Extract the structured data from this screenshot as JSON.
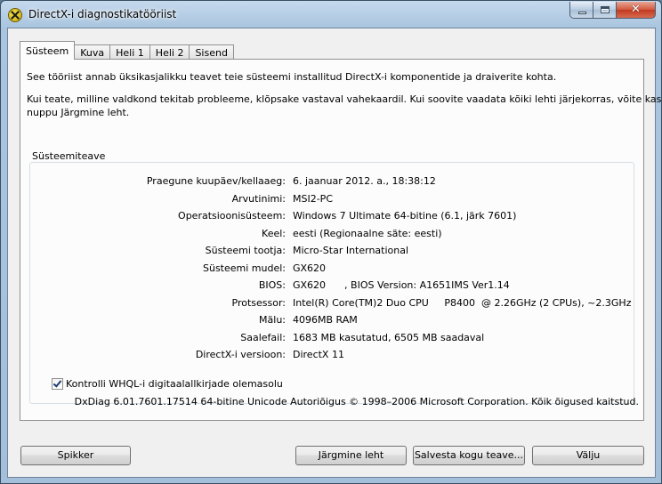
{
  "window": {
    "title": "DirectX-i diagnostikatööriist"
  },
  "tabs": [
    {
      "label": "Süsteem",
      "active": true
    },
    {
      "label": "Kuva"
    },
    {
      "label": "Heli 1"
    },
    {
      "label": "Heli 2"
    },
    {
      "label": "Sisend"
    }
  ],
  "intro": {
    "line1": "See tööriist annab üksikasjalikku teavet teie süsteemi installitud DirectX-i komponentide ja draiverite kohta.",
    "line2": "Kui teate, milline valdkond tekitab probleeme, klõpsake vastaval vahekaardil. Kui soovite vaadata kõiki lehti järjekorras, võite kasutada",
    "line3": "nuppu Järgmine leht."
  },
  "system_info": {
    "title": "Süsteemiteave",
    "rows": [
      {
        "label": "Praegune kuupäev/kellaaeg:",
        "value": "6. jaanuar 2012. a., 18:38:12"
      },
      {
        "label": "Arvutinimi:",
        "value": "MSI2-PC"
      },
      {
        "label": "Operatsioonisüsteem:",
        "value": "Windows 7 Ultimate 64-bitine (6.1, järk 7601)"
      },
      {
        "label": "Keel:",
        "value": "eesti (Regionaalne säte: eesti)"
      },
      {
        "label": "Süsteemi tootja:",
        "value": "Micro-Star International"
      },
      {
        "label": "Süsteemi mudel:",
        "value": "GX620"
      },
      {
        "label": "BIOS:",
        "value": "GX620      , BIOS Version: A1651IMS Ver1.14"
      },
      {
        "label": "Protsessor:",
        "value": "Intel(R) Core(TM)2 Duo CPU     P8400  @ 2.26GHz (2 CPUs), ~2.3GHz"
      },
      {
        "label": "Mälu:",
        "value": "4096MB RAM"
      },
      {
        "label": "Saalefail:",
        "value": "1683 MB kasutatud, 6505 MB saadaval"
      },
      {
        "label": "DirectX-i versioon:",
        "value": "DirectX 11"
      }
    ]
  },
  "whql_checkbox": {
    "label": "Kontrolli WHQL-i digitaalallkirjade olemasolu",
    "checked": true
  },
  "copyright": "DxDiag 6.01.7601.17514 64-bitine Unicode Autoriõigus © 1998–2006 Microsoft Corporation.  Kõik õigused kaitstud.",
  "buttons": {
    "help": "Spikker",
    "next": "Järgmine leht",
    "save": "Salvesta kogu teave...",
    "exit": "Välju"
  }
}
